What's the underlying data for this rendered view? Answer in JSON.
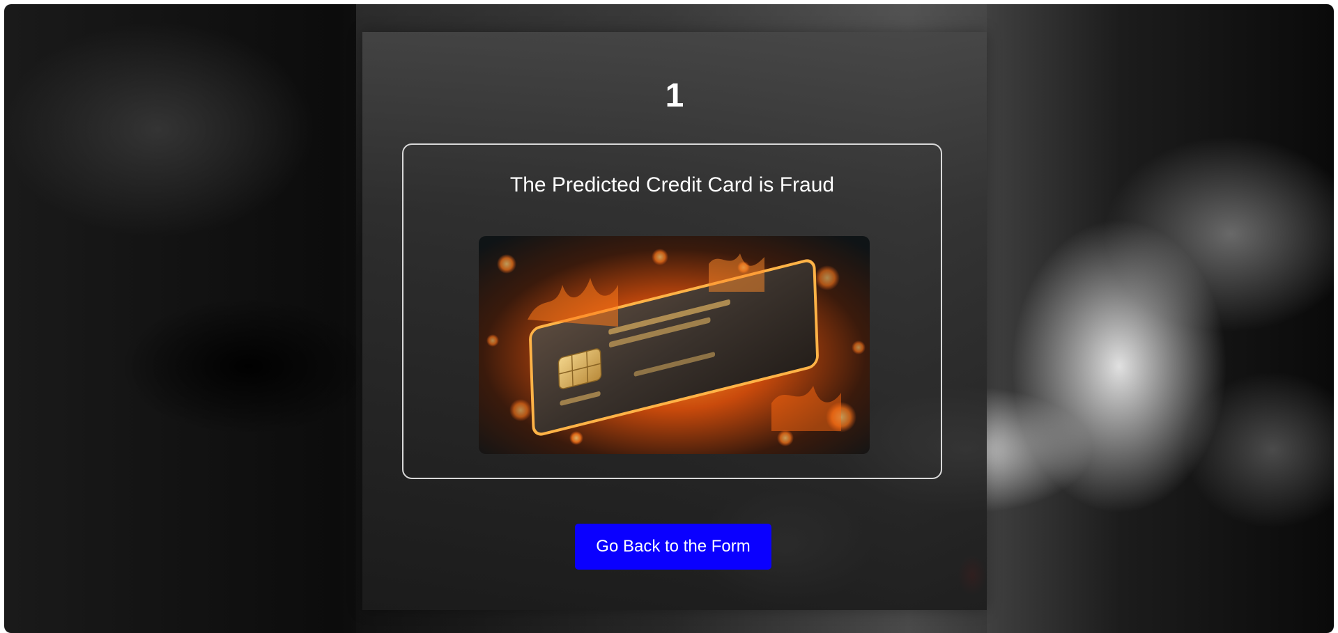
{
  "result": {
    "number": "1",
    "message": "The Predicted Credit Card is Fraud"
  },
  "image": {
    "icon": "burning-credit-card-image"
  },
  "actions": {
    "back_label": "Go Back to the Form"
  },
  "colors": {
    "button_bg": "#0a00ff",
    "text": "#ffffff",
    "box_border": "#d9d9d9"
  }
}
